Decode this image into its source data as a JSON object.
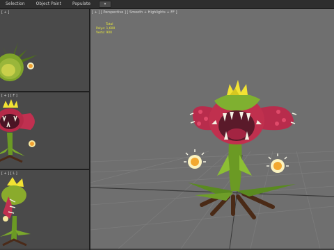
{
  "menubar": {
    "items": [
      "Selection",
      "Object Paint",
      "Populate"
    ],
    "extra_icon": "viewport-layout-icon"
  },
  "viewports": {
    "top_label": "[ + ]",
    "front_label": "[ + ] [ F ]",
    "left_label": "[ + ] [ L ]",
    "main_label": "[ + ] [ Perspective ] [ Smooth + Highlights + FF ]",
    "stats": {
      "title": "Total",
      "polys": "Polys: 1,600",
      "verts": "Verts: 900"
    }
  },
  "colors": {
    "viewport_bg": "#4a4a4a",
    "perspective_bg": "#6f6f6f",
    "grid_line": "#7c7c7c",
    "plant_green": "#6b9a24",
    "mouth_red": "#c03050",
    "flower_yellow": "#f2e233"
  }
}
